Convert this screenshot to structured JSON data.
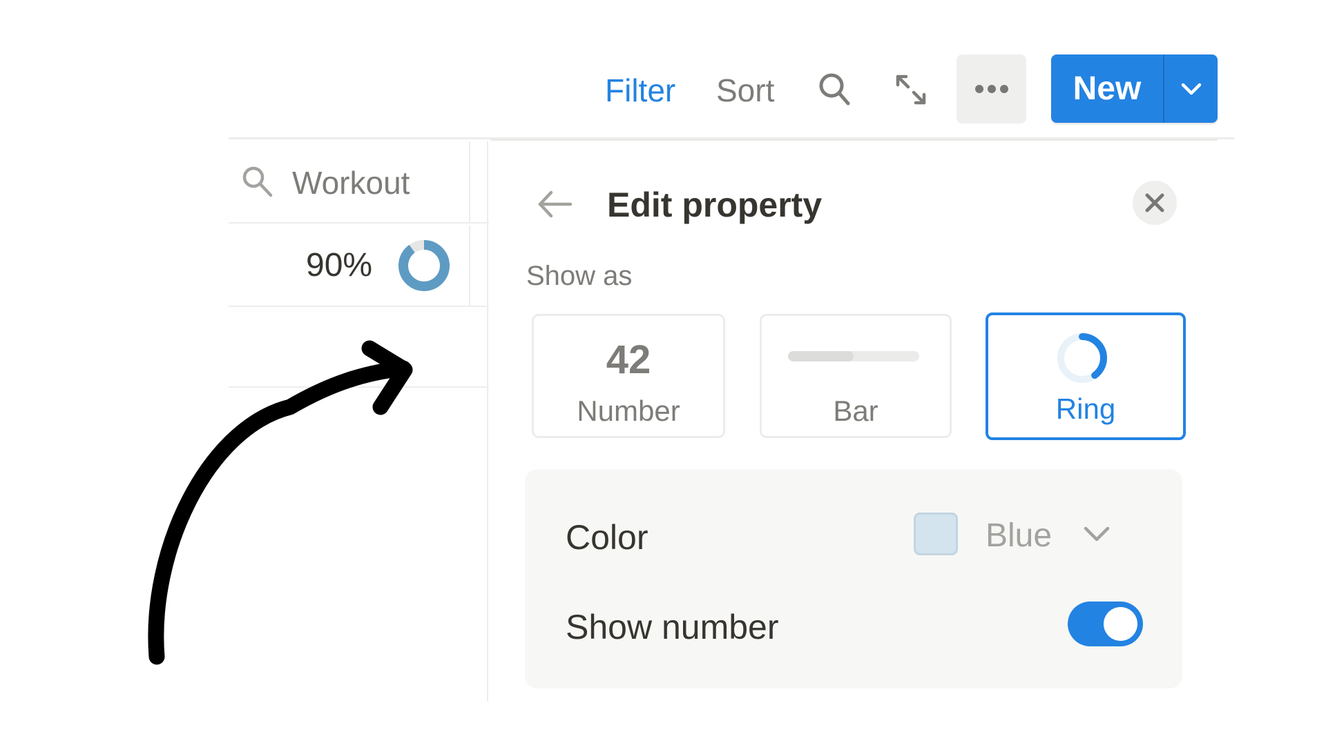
{
  "toolbar": {
    "filter_label": "Filter",
    "sort_label": "Sort",
    "search_icon": "search-icon",
    "expand_icon": "expand-icon",
    "more_icon": "more-horizontal-icon",
    "new_label": "New",
    "new_dropdown_icon": "chevron-down-icon"
  },
  "table": {
    "header": {
      "icon": "search-icon",
      "label": "Workout"
    },
    "rows": [
      {
        "value_text": "90%",
        "progress": 0.9,
        "display": "ring"
      },
      {
        "value_text": ""
      }
    ]
  },
  "panel": {
    "back_icon": "arrow-left-icon",
    "title": "Edit property",
    "close_icon": "close-icon",
    "show_as_label": "Show as",
    "options": [
      {
        "id": "number",
        "preview": "42",
        "label": "Number",
        "selected": false
      },
      {
        "id": "bar",
        "label": "Bar",
        "preview_progress": 0.5,
        "selected": false
      },
      {
        "id": "ring",
        "label": "Ring",
        "preview_progress": 0.4,
        "selected": true
      }
    ],
    "settings": {
      "color_label": "Color",
      "color_value": "Blue",
      "color_swatch": "#d3e4ef",
      "show_number_label": "Show number",
      "show_number_enabled": true
    }
  },
  "colors": {
    "accent": "#2383e2",
    "ring_blue": "#5e9bc3",
    "text_primary": "#37352f",
    "text_secondary": "#7d7c78"
  },
  "annotation": {
    "type": "hand-drawn-arrow",
    "color": "#000000"
  }
}
